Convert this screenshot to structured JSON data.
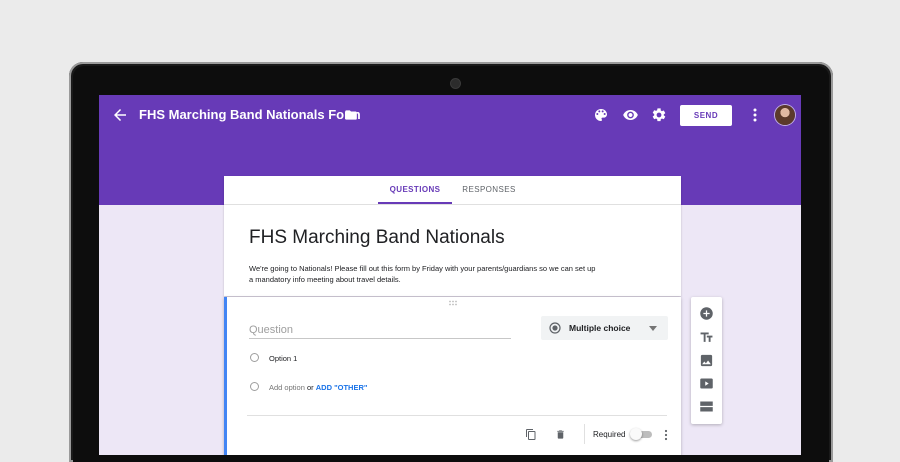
{
  "form": {
    "header_title": "FHS Marching Band Nationals Form",
    "send_label": "SEND",
    "tabs": [
      {
        "label": "QUESTIONS",
        "active": true
      },
      {
        "label": "RESPONSES",
        "active": false
      }
    ],
    "title": "FHS Marching Band Nationals",
    "description": "We're going to Nationals! Please fill out this form by Friday with your parents/guardians so we can set up a mandatory info meeting about travel details."
  },
  "question": {
    "placeholder": "Question",
    "type_label": "Multiple choice",
    "options": [
      "Option 1"
    ],
    "add_option_label": "Add option",
    "or_label": "or",
    "add_other_label": "ADD \"OTHER\"",
    "required_label": "Required",
    "required": false
  },
  "toolbar": {
    "icons": [
      "add-question-icon",
      "title-icon",
      "image-icon",
      "video-icon",
      "section-icon"
    ]
  },
  "colors": {
    "brand": "#673ab7",
    "background": "#ede7f6",
    "focus": "#4285f4",
    "link": "#1a73e8"
  }
}
